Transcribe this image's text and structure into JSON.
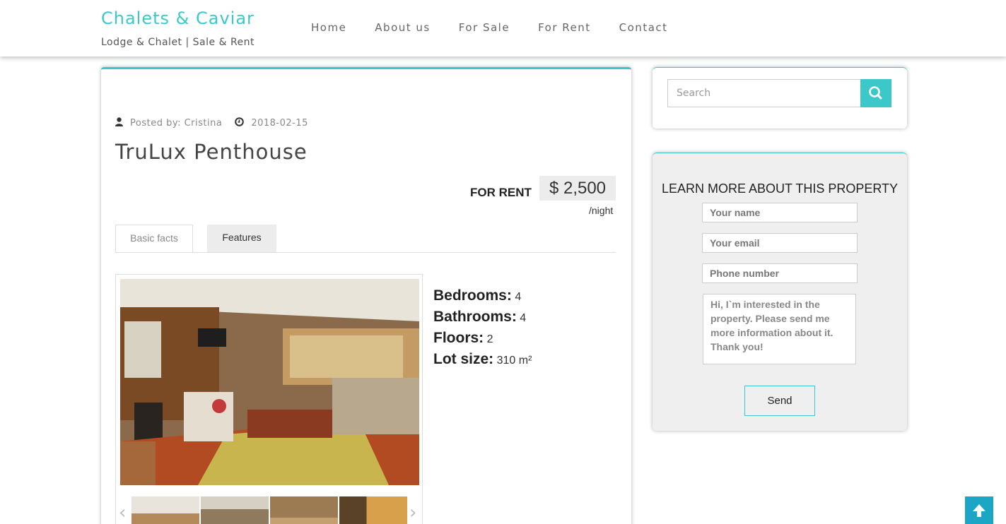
{
  "site": {
    "title": "Chalets & Caviar",
    "tagline": "Lodge & Chalet | Sale & Rent"
  },
  "nav": {
    "items": [
      {
        "label": "Home"
      },
      {
        "label": "About us"
      },
      {
        "label": "For Sale"
      },
      {
        "label": "For Rent"
      },
      {
        "label": "Contact"
      }
    ]
  },
  "post": {
    "posted_by": "Posted by: Cristina",
    "date": "2018-02-15",
    "title": "TruLux Penthouse",
    "status": "FOR RENT",
    "price": "$ 2,500",
    "price_unit": "/night"
  },
  "tabs": [
    {
      "label": "Basic facts",
      "active": false
    },
    {
      "label": "Features",
      "active": true
    }
  ],
  "facts": {
    "bedrooms_label": "Bedrooms:",
    "bedrooms": "4",
    "bathrooms_label": "Bathrooms:",
    "bathrooms": "4",
    "floors_label": "Floors:",
    "floors": "2",
    "lot_label": "Lot size:",
    "lot": "310 m²"
  },
  "gallery": {
    "prev_icon": "‹",
    "next_icon": "›"
  },
  "search": {
    "placeholder": "Search",
    "icon": "search-icon"
  },
  "contact_form": {
    "heading": "LEARN MORE ABOUT THIS PROPERTY",
    "name_placeholder": "Your name",
    "email_placeholder": "Your email",
    "phone_placeholder": "Phone number",
    "message": "Hi, I`m interested in the property. Please send me more information about it. Thank you!",
    "send_label": "Send"
  },
  "colors": {
    "accent": "#3cc8c8",
    "to_top": "#1ca6c6"
  }
}
